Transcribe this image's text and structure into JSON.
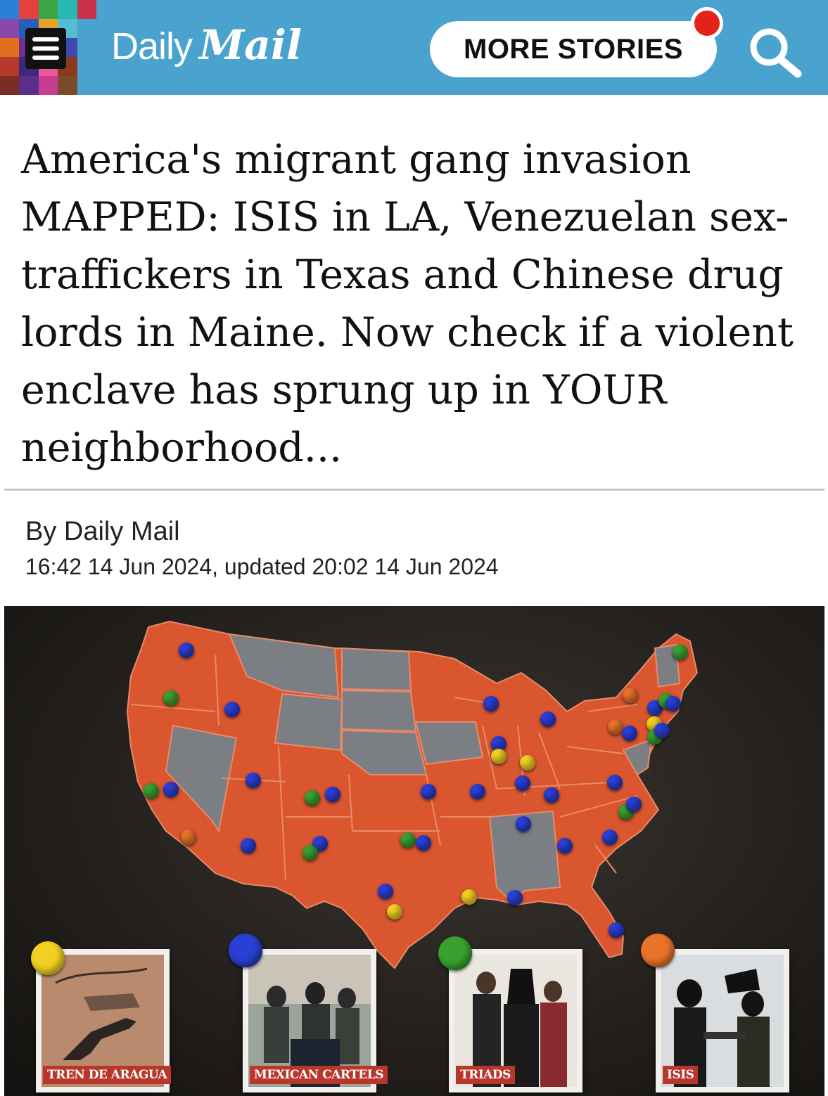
{
  "header": {
    "logo_daily": "Daily",
    "logo_mail": "Mail",
    "more_stories_label": "MORE STORIES",
    "background_color": "#4aa3cf",
    "notification_color": "#e2231a"
  },
  "article": {
    "headline": "America's migrant gang invasion MAPPED: ISIS in LA, Venezuelan sex-traffickers in Texas and Chinese drug lords in Maine. Now check if a violent enclave has sprung up in YOUR neighborhood...",
    "byline": "By Daily Mail",
    "dateline": "16:42 14 Jun 2024, updated 20:02 14 Jun 2024"
  },
  "map_legend": [
    {
      "label": "TREN DE ARAGUA",
      "color": "#f0d020"
    },
    {
      "label": "MEXICAN CARTELS",
      "color": "#2a3fd6"
    },
    {
      "label": "TRIADS",
      "color": "#3aa030"
    },
    {
      "label": "ISIS",
      "color": "#e8742a"
    }
  ],
  "colors": {
    "gang_state": "#d9562f",
    "other_state": "#7b7f84",
    "label_red": "#b8372a"
  }
}
